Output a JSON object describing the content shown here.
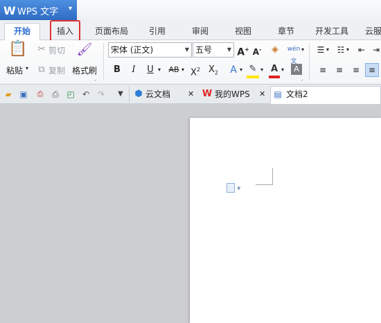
{
  "app": {
    "title": "WPS 文字"
  },
  "tabs": [
    "开始",
    "插入",
    "页面布局",
    "引用",
    "审阅",
    "视图",
    "章节",
    "开发工具",
    "云服"
  ],
  "clipboard": {
    "paste": "粘贴",
    "cut": "剪切",
    "copy": "复制",
    "format_painter": "格式刷"
  },
  "font": {
    "name": "宋体 (正文)",
    "size": "五号"
  },
  "docs": {
    "cloud": "云文档",
    "mywps": "我的WPS",
    "current": "文档2"
  },
  "colors": {
    "accent": "#2b6bd3",
    "highlight": "#e03232"
  }
}
